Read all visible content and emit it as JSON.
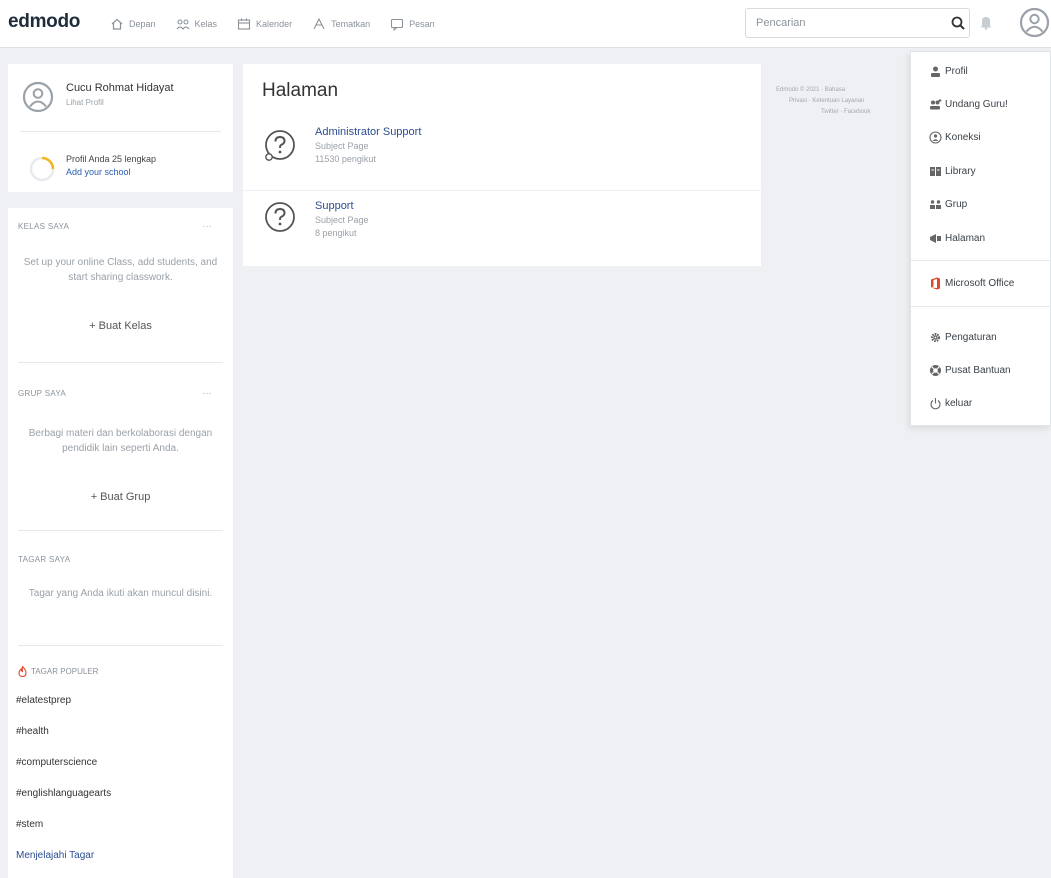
{
  "header": {
    "logo": "edmodo",
    "nav": [
      {
        "label": "Depan",
        "icon": "home-icon"
      },
      {
        "label": "Kelas",
        "icon": "classes-icon"
      },
      {
        "label": "Kalender",
        "icon": "calendar-icon"
      },
      {
        "label": "Tematkan",
        "icon": "discover-icon"
      },
      {
        "label": "Pesan",
        "icon": "messages-icon"
      }
    ],
    "search_placeholder": "Pencarian"
  },
  "profile": {
    "name": "Cucu Rohmat Hidayat",
    "link": "Lihat Profil",
    "progress_text": "Profil Anda 25 lengkap",
    "progress_link": "Add your school",
    "progress_fraction": 0.25
  },
  "sidebar": {
    "classes_heading": "KELAS SAYA",
    "classes_more": "…",
    "classes_desc": "Set up your online Class, add students, and start sharing classwork.",
    "classes_button": "+ Buat Kelas",
    "groups_heading": "GRUP SAYA",
    "groups_more": "…",
    "groups_desc": "Berbagi materi dan berkolaborasi dengan pendidik lain seperti Anda.",
    "groups_button": "+ Buat Grup",
    "tags_heading": "TAGAR SAYA",
    "tags_desc": "Tagar yang Anda ikuti akan muncul disini.",
    "popular_heading": "TAGAR POPULER",
    "popular_tags": [
      "#elatestprep",
      "#health",
      "#computerscience",
      "#englishlanguagearts",
      "#stem"
    ],
    "explore_link": "Menjelajahi Tagar"
  },
  "main": {
    "title": "Halaman",
    "pages": [
      {
        "name": "Administrator Support",
        "type": "Subject Page",
        "followers": "11530 pengikut"
      },
      {
        "name": "Support",
        "type": "Subject Page",
        "followers": "8 pengikut"
      }
    ]
  },
  "footer": {
    "line1": "Edmodo © 2021 · Bahasa",
    "line2": "Privasi · Ketentuan Layanan",
    "line3": "Twitter · Facebook"
  },
  "dropdown": {
    "items": [
      {
        "label": "Profil",
        "icon": "person-icon"
      },
      {
        "label": "Undang Guru!",
        "icon": "invite-teacher-icon"
      },
      {
        "label": "Koneksi",
        "icon": "connections-icon"
      },
      {
        "label": "Library",
        "icon": "library-icon"
      },
      {
        "label": "Grup",
        "icon": "groups-icon"
      },
      {
        "label": "Halaman",
        "icon": "pages-icon"
      },
      {
        "label": "Microsoft Office",
        "icon": "microsoft-office-icon"
      },
      {
        "label": "Pengaturan",
        "icon": "gear-icon"
      },
      {
        "label": "Pusat Bantuan",
        "icon": "help-center-icon"
      },
      {
        "label": "keluar",
        "icon": "power-icon"
      }
    ]
  },
  "colors": {
    "link": "#2a4d8f",
    "progress": "#f5b320",
    "office": "#e2492b"
  }
}
